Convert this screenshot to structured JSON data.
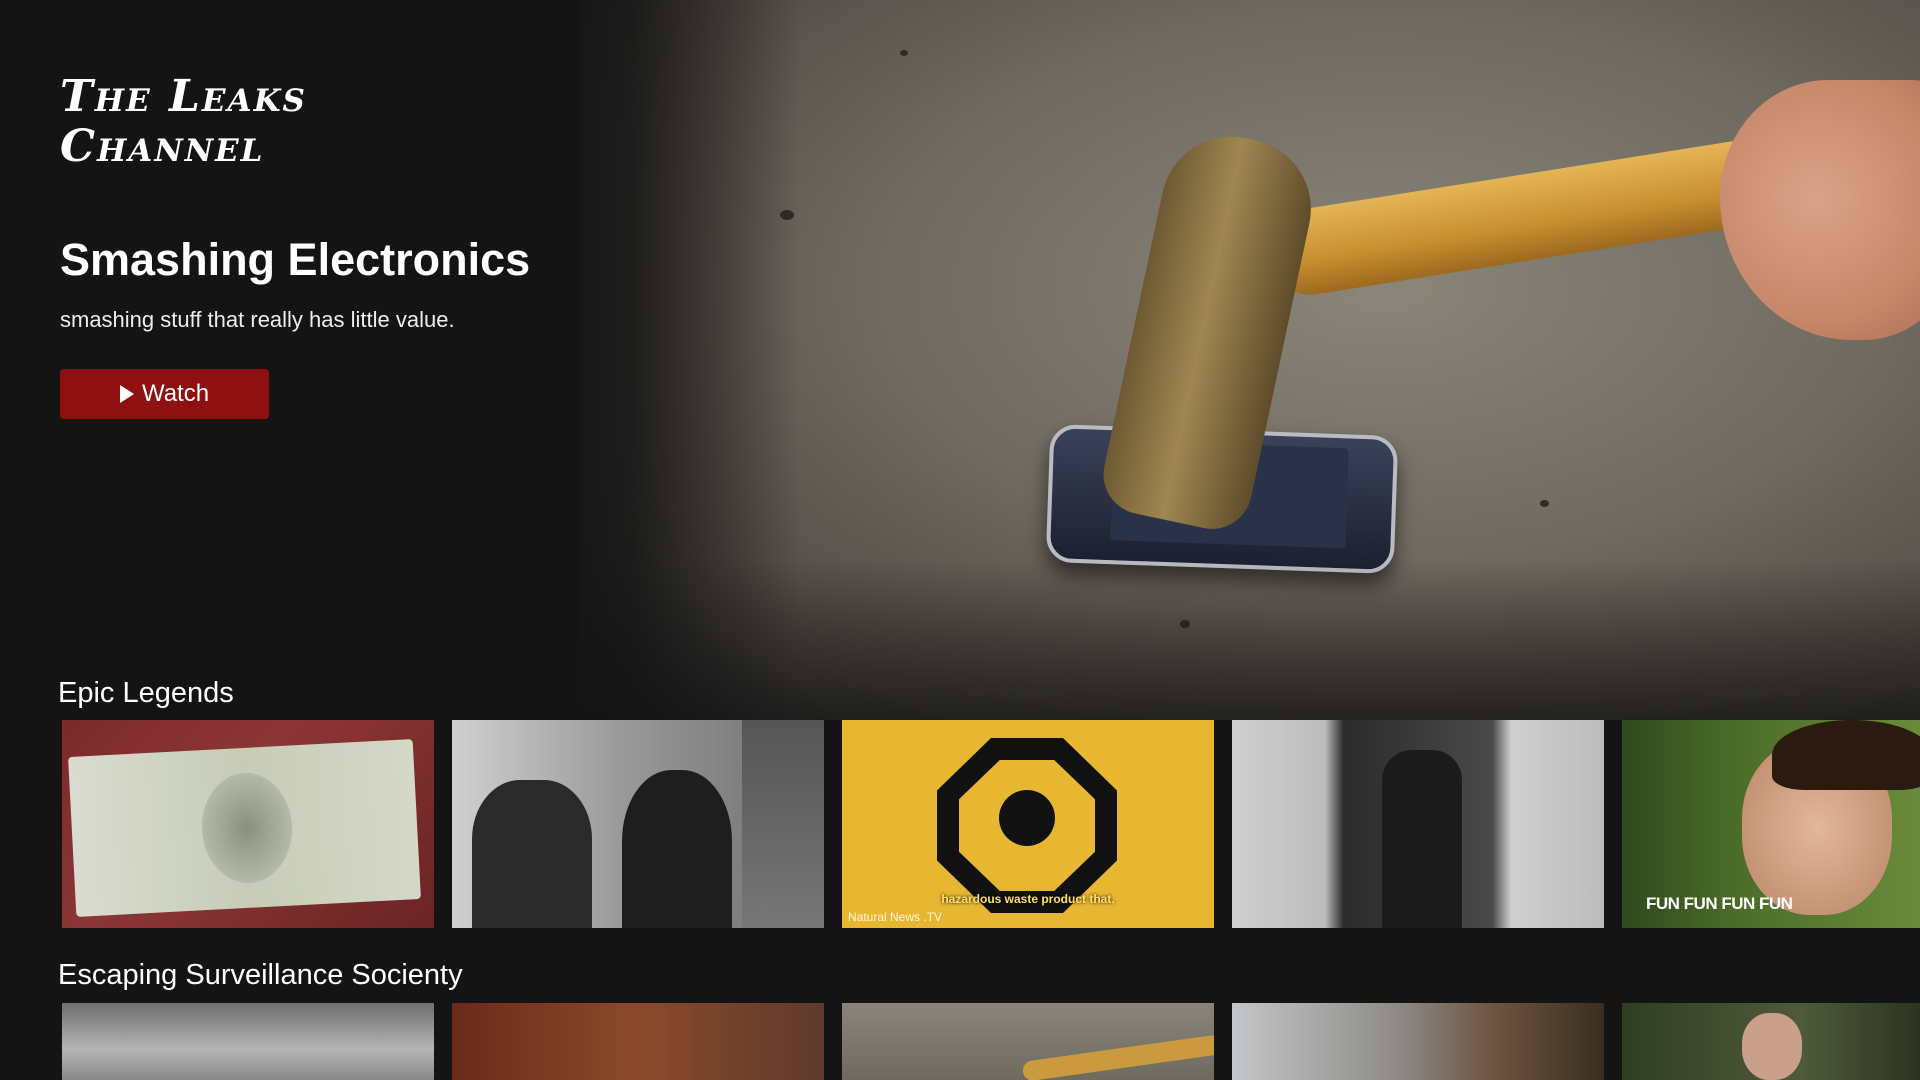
{
  "brand": {
    "logo_line1": "The Leaks",
    "logo_line2": "Channel"
  },
  "hero": {
    "title": "Smashing Electronics",
    "description": "smashing stuff that really has little value.",
    "watch_label": "Watch"
  },
  "rows": [
    {
      "title": "Epic Legends",
      "tiles": [
        {
          "subject": "twenty-dollar bill",
          "caption": "",
          "overlay": ""
        },
        {
          "subject": "street photographers",
          "caption": "",
          "overlay": ""
        },
        {
          "subject": "hazard skull sign",
          "caption": "hazardous waste product that,",
          "brand": "Natural News .TV",
          "overlay": ""
        },
        {
          "subject": "newspaper and gangster",
          "caption": "",
          "overlay": ""
        },
        {
          "subject": "smiling girl",
          "caption": "",
          "overlay": "FUN FUN FUN FUN"
        }
      ]
    },
    {
      "title": "Escaping Surveillance Socienty",
      "tiles": [
        {
          "subject": "metal pot"
        },
        {
          "subject": "woman by house"
        },
        {
          "subject": "hammer smashing phone"
        },
        {
          "subject": "doorway"
        },
        {
          "subject": "man in forest"
        }
      ]
    }
  ],
  "colors": {
    "accent": "#8e1010",
    "background": "#141414"
  }
}
